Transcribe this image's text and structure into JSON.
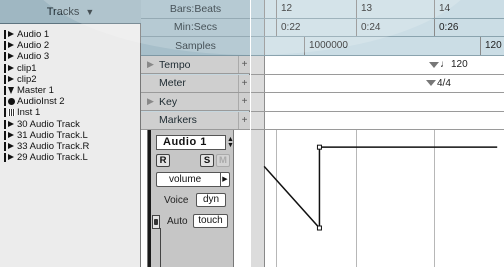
{
  "tracks_panel": {
    "header": "Tracks",
    "items": [
      {
        "name": "Audio 1",
        "type": "audio"
      },
      {
        "name": "Audio 2",
        "type": "audio"
      },
      {
        "name": "Audio 3",
        "type": "audio"
      },
      {
        "name": "clip1",
        "type": "audio"
      },
      {
        "name": "clip2",
        "type": "audio"
      },
      {
        "name": "Master 1",
        "type": "master"
      },
      {
        "name": "AudioInst  2",
        "type": "aux"
      },
      {
        "name": "Inst 1",
        "type": "inst"
      },
      {
        "name": "30 Audio Track",
        "type": "audio"
      },
      {
        "name": "31 Audio Track.L",
        "type": "audio"
      },
      {
        "name": "33 Audio Track.R",
        "type": "audio"
      },
      {
        "name": "29 Audio Track.L",
        "type": "audio"
      }
    ]
  },
  "rulers": {
    "bars_beats": {
      "label": "Bars:Beats",
      "ticks": [
        "12",
        "13",
        "14"
      ]
    },
    "min_secs": {
      "label": "Min:Secs",
      "ticks": [
        "0:22",
        "0:24",
        "0:26"
      ]
    },
    "samples": {
      "label": "Samples",
      "ticks": [
        "1000000",
        "120"
      ]
    },
    "tempo": {
      "label": "Tempo",
      "marker": "120"
    },
    "meter": {
      "label": "Meter",
      "marker": "4/4"
    },
    "key": {
      "label": "Key"
    },
    "markers": {
      "label": "Markers"
    }
  },
  "track_controls": {
    "name": "Audio 1",
    "record_label": "R",
    "solo_label": "S",
    "mute_label": "M",
    "view": "volume",
    "voice_label": "Voice",
    "voice_value": "dyn",
    "auto_label": "Auto",
    "auto_value": "touch"
  },
  "colors": {
    "ruler_blue": "#c5d6de",
    "header_blue": "#9fb7c2",
    "control_gray": "#c6c6c6"
  },
  "automation": {
    "parameter": "volume",
    "breakpoints": [
      {
        "bar": 11.85,
        "level": 0.72
      },
      {
        "bar": 12.55,
        "level": 0.27
      },
      {
        "bar": 12.55,
        "level": 0.86
      },
      {
        "bar": 14.8,
        "level": 0.86
      }
    ]
  }
}
